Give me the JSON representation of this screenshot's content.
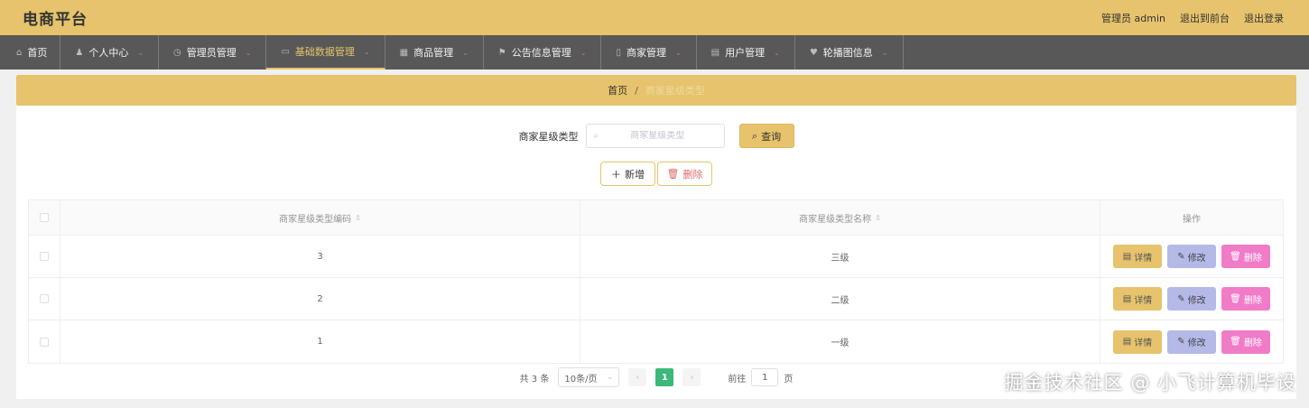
{
  "app": {
    "title": "电商平台"
  },
  "top_links": {
    "admin": "管理员 admin",
    "front": "退出到前台",
    "logout": "退出登录"
  },
  "nav": [
    {
      "label": "首页",
      "icon": "⌂"
    },
    {
      "label": "个人中心",
      "icon": "♟"
    },
    {
      "label": "管理员管理",
      "icon": "◷"
    },
    {
      "label": "基础数据管理",
      "icon": "▭"
    },
    {
      "label": "商品管理",
      "icon": "▦"
    },
    {
      "label": "公告信息管理",
      "icon": "⚑"
    },
    {
      "label": "商家管理",
      "icon": "▯"
    },
    {
      "label": "用户管理",
      "icon": "▤"
    },
    {
      "label": "轮播图信息",
      "icon": "♥"
    }
  ],
  "breadcrumb": {
    "home": "首页",
    "sep": "/",
    "current": "商家星级类型"
  },
  "search": {
    "label": "商家星级类型",
    "placeholder": "商家星级类型",
    "button": "查询"
  },
  "actions": {
    "add": "新增",
    "delete": "删除"
  },
  "table": {
    "headers": [
      "商家星级类型编码",
      "商家星级类型名称",
      "操作"
    ],
    "rows": [
      {
        "code": "3",
        "name": "三级"
      },
      {
        "code": "2",
        "name": "二级"
      },
      {
        "code": "1",
        "name": "一级"
      }
    ],
    "op": {
      "detail": "详情",
      "edit": "修改",
      "delete": "删除"
    }
  },
  "pagination": {
    "total": "共 3 条",
    "page_size": "10条/页",
    "current": "1",
    "goto": "前往",
    "goto_value": "1",
    "page": "页"
  },
  "watermark": "掘金技术社区 @ 小飞计算机毕设",
  "colors": {
    "accent": "#e6c36c",
    "nav_bg": "#585858",
    "pager_active": "#3cb878",
    "edit": "#b5b9e8",
    "delete": "#f07cc8"
  }
}
